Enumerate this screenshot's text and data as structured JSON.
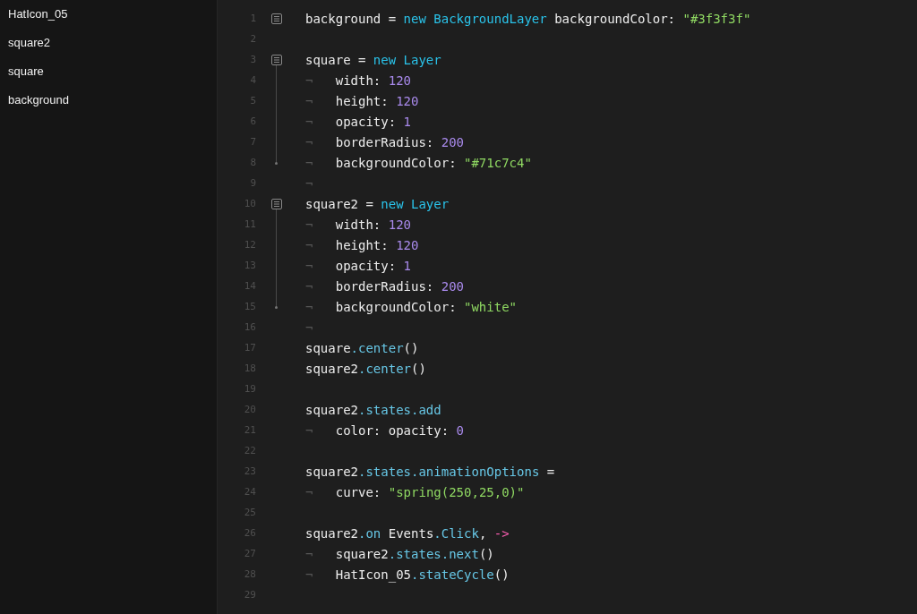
{
  "sidebar": {
    "items": [
      {
        "label": "HatIcon_05"
      },
      {
        "label": "square2"
      },
      {
        "label": "square"
      },
      {
        "label": "background"
      }
    ]
  },
  "editor": {
    "lines": [
      {
        "number": "1",
        "fold_start": true,
        "fold_end": false,
        "tokens": [
          {
            "kind": "plain",
            "text": "background = "
          },
          {
            "kind": "keyword",
            "text": "new BackgroundLayer"
          },
          {
            "kind": "plain",
            "text": " backgroundColor: "
          },
          {
            "kind": "string",
            "text": "\"#3f3f3f\""
          }
        ]
      },
      {
        "number": "2",
        "fold_start": false,
        "fold_end": false
      },
      {
        "number": "3",
        "fold_start": true,
        "fold_end": false,
        "tokens": [
          {
            "kind": "plain",
            "text": "square = "
          },
          {
            "kind": "keyword",
            "text": "new Layer"
          }
        ]
      },
      {
        "number": "4",
        "fold_start": false,
        "fold_end": false,
        "tokens": [
          {
            "kind": "tab",
            "text": "¬   "
          },
          {
            "kind": "plain",
            "text": "width: "
          },
          {
            "kind": "number",
            "text": "120"
          }
        ]
      },
      {
        "number": "5",
        "fold_start": false,
        "fold_end": false,
        "tokens": [
          {
            "kind": "tab",
            "text": "¬   "
          },
          {
            "kind": "plain",
            "text": "height: "
          },
          {
            "kind": "number",
            "text": "120"
          }
        ]
      },
      {
        "number": "6",
        "fold_start": false,
        "fold_end": false,
        "tokens": [
          {
            "kind": "tab",
            "text": "¬   "
          },
          {
            "kind": "plain",
            "text": "opacity: "
          },
          {
            "kind": "number",
            "text": "1"
          }
        ]
      },
      {
        "number": "7",
        "fold_start": false,
        "fold_end": false,
        "tokens": [
          {
            "kind": "tab",
            "text": "¬   "
          },
          {
            "kind": "plain",
            "text": "borderRadius: "
          },
          {
            "kind": "number",
            "text": "200"
          }
        ]
      },
      {
        "number": "8",
        "fold_start": false,
        "fold_end": true,
        "tokens": [
          {
            "kind": "tab",
            "text": "¬   "
          },
          {
            "kind": "plain",
            "text": "backgroundColor: "
          },
          {
            "kind": "string",
            "text": "\"#71c7c4\""
          }
        ]
      },
      {
        "number": "9",
        "fold_start": false,
        "fold_end": false,
        "tokens": [
          {
            "kind": "tab",
            "text": "¬"
          }
        ]
      },
      {
        "number": "10",
        "fold_start": true,
        "fold_end": false,
        "tokens": [
          {
            "kind": "plain",
            "text": "square2 = "
          },
          {
            "kind": "keyword",
            "text": "new Layer"
          }
        ]
      },
      {
        "number": "11",
        "fold_start": false,
        "fold_end": false,
        "tokens": [
          {
            "kind": "tab",
            "text": "¬   "
          },
          {
            "kind": "plain",
            "text": "width: "
          },
          {
            "kind": "number",
            "text": "120"
          }
        ]
      },
      {
        "number": "12",
        "fold_start": false,
        "fold_end": false,
        "tokens": [
          {
            "kind": "tab",
            "text": "¬   "
          },
          {
            "kind": "plain",
            "text": "height: "
          },
          {
            "kind": "number",
            "text": "120"
          }
        ]
      },
      {
        "number": "13",
        "fold_start": false,
        "fold_end": false,
        "tokens": [
          {
            "kind": "tab",
            "text": "¬   "
          },
          {
            "kind": "plain",
            "text": "opacity: "
          },
          {
            "kind": "number",
            "text": "1"
          }
        ]
      },
      {
        "number": "14",
        "fold_start": false,
        "fold_end": false,
        "tokens": [
          {
            "kind": "tab",
            "text": "¬   "
          },
          {
            "kind": "plain",
            "text": "borderRadius: "
          },
          {
            "kind": "number",
            "text": "200"
          }
        ]
      },
      {
        "number": "15",
        "fold_start": false,
        "fold_end": true,
        "tokens": [
          {
            "kind": "tab",
            "text": "¬   "
          },
          {
            "kind": "plain",
            "text": "backgroundColor: "
          },
          {
            "kind": "string",
            "text": "\"white\""
          }
        ]
      },
      {
        "number": "16",
        "fold_start": false,
        "fold_end": false,
        "tokens": [
          {
            "kind": "tab",
            "text": "¬"
          }
        ]
      },
      {
        "number": "17",
        "fold_start": false,
        "fold_end": false,
        "tokens": [
          {
            "kind": "plain",
            "text": "square"
          },
          {
            "kind": "member",
            "text": ".center"
          },
          {
            "kind": "plain",
            "text": "()"
          }
        ]
      },
      {
        "number": "18",
        "fold_start": false,
        "fold_end": false,
        "tokens": [
          {
            "kind": "plain",
            "text": "square2"
          },
          {
            "kind": "member",
            "text": ".center"
          },
          {
            "kind": "plain",
            "text": "()"
          }
        ]
      },
      {
        "number": "19",
        "fold_start": false,
        "fold_end": false
      },
      {
        "number": "20",
        "fold_start": false,
        "fold_end": false,
        "tokens": [
          {
            "kind": "plain",
            "text": "square2"
          },
          {
            "kind": "member",
            "text": ".states.add"
          }
        ]
      },
      {
        "number": "21",
        "fold_start": false,
        "fold_end": false,
        "tokens": [
          {
            "kind": "tab",
            "text": "¬   "
          },
          {
            "kind": "plain",
            "text": "color: opacity: "
          },
          {
            "kind": "number",
            "text": "0"
          }
        ]
      },
      {
        "number": "22",
        "fold_start": false,
        "fold_end": false
      },
      {
        "number": "23",
        "fold_start": false,
        "fold_end": false,
        "tokens": [
          {
            "kind": "plain",
            "text": "square2"
          },
          {
            "kind": "member",
            "text": ".states.animationOptions"
          },
          {
            "kind": "plain",
            "text": " ="
          }
        ]
      },
      {
        "number": "24",
        "fold_start": false,
        "fold_end": false,
        "tokens": [
          {
            "kind": "tab",
            "text": "¬   "
          },
          {
            "kind": "plain",
            "text": "curve: "
          },
          {
            "kind": "string",
            "text": "\"spring(250,25,0)\""
          }
        ]
      },
      {
        "number": "25",
        "fold_start": false,
        "fold_end": false
      },
      {
        "number": "26",
        "fold_start": false,
        "fold_end": false,
        "tokens": [
          {
            "kind": "plain",
            "text": "square2"
          },
          {
            "kind": "member",
            "text": ".on"
          },
          {
            "kind": "plain",
            "text": " Events"
          },
          {
            "kind": "member",
            "text": ".Click"
          },
          {
            "kind": "plain",
            "text": ", "
          },
          {
            "kind": "arrow",
            "text": "->"
          }
        ]
      },
      {
        "number": "27",
        "fold_start": false,
        "fold_end": false,
        "tokens": [
          {
            "kind": "tab",
            "text": "¬   "
          },
          {
            "kind": "plain",
            "text": "square2"
          },
          {
            "kind": "member",
            "text": ".states.next"
          },
          {
            "kind": "plain",
            "text": "()"
          }
        ]
      },
      {
        "number": "28",
        "fold_start": false,
        "fold_end": false,
        "tokens": [
          {
            "kind": "tab",
            "text": "¬   "
          },
          {
            "kind": "plain",
            "text": "HatIcon_05"
          },
          {
            "kind": "member",
            "text": ".stateCycle"
          },
          {
            "kind": "plain",
            "text": "()"
          }
        ]
      },
      {
        "number": "29",
        "fold_start": false,
        "fold_end": false
      }
    ]
  }
}
